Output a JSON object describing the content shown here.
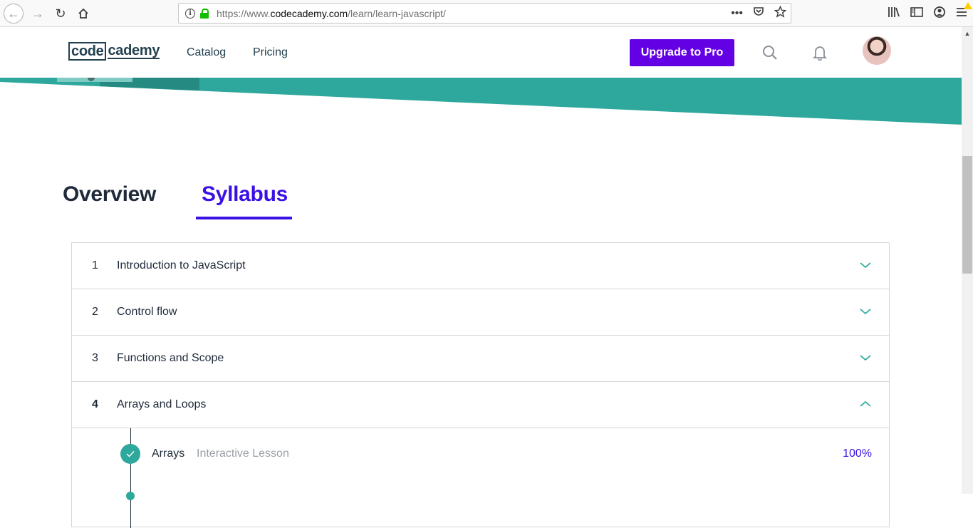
{
  "browser": {
    "url_prefix": "https://www.",
    "url_domain": "codecademy.com",
    "url_path": "/learn/learn-javascript/",
    "page_actions_label": "•••"
  },
  "header": {
    "logo_boxed": "code",
    "logo_rest": "cademy",
    "nav": [
      "Catalog",
      "Pricing"
    ],
    "upgrade_label": "Upgrade to Pro"
  },
  "colors": {
    "brand_purple": "#6400e4",
    "accent_blue": "#3a10e5",
    "teal": "#2ea89c"
  },
  "tabs": [
    {
      "label": "Overview",
      "active": false
    },
    {
      "label": "Syllabus",
      "active": true
    }
  ],
  "modules": [
    {
      "number": "1",
      "title": "Introduction to JavaScript",
      "expanded": false
    },
    {
      "number": "2",
      "title": "Control flow",
      "expanded": false
    },
    {
      "number": "3",
      "title": "Functions and Scope",
      "expanded": false
    },
    {
      "number": "4",
      "title": "Arrays and Loops",
      "expanded": true
    }
  ],
  "lessons": [
    {
      "title": "Arrays",
      "type": "Interactive Lesson",
      "progress": "100%",
      "completed": true
    }
  ]
}
